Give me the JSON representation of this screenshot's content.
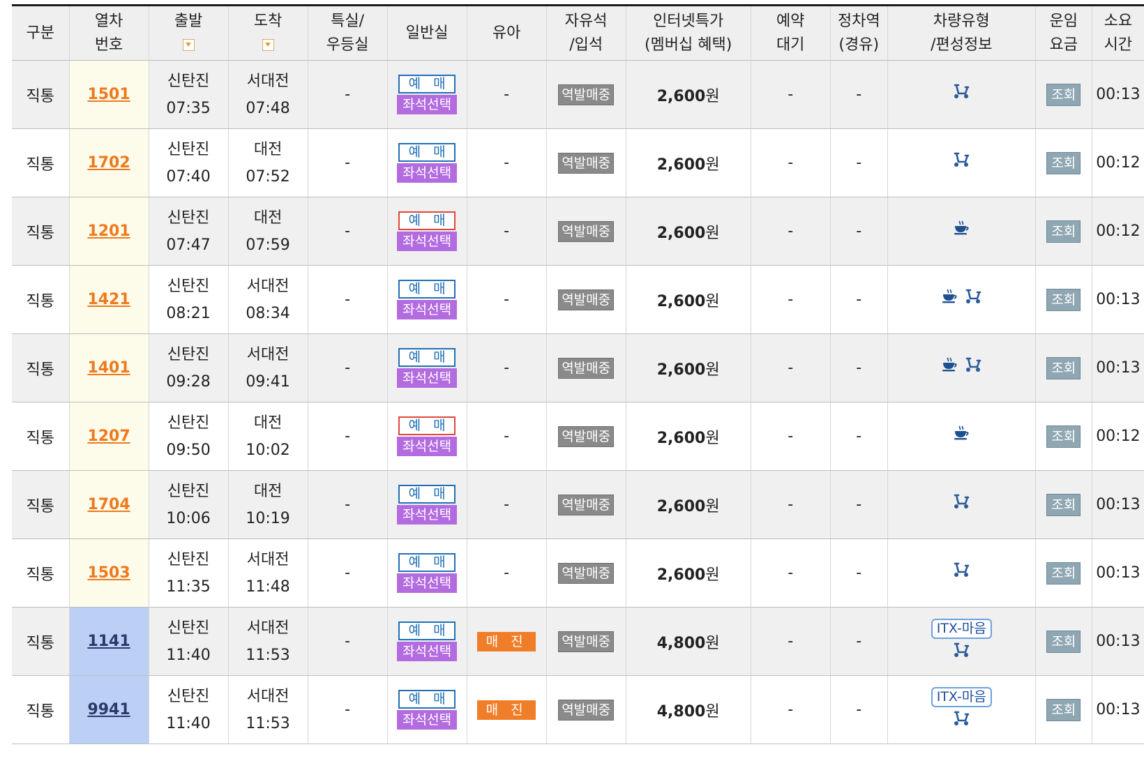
{
  "header": {
    "category": "구분",
    "train_no": [
      "열차",
      "번호"
    ],
    "depart": "출발",
    "arrive": "도착",
    "special": [
      "특실/",
      "우등실"
    ],
    "general": "일반실",
    "infant": "유아",
    "free_seat": [
      "자유석",
      "/입석"
    ],
    "internet_price": [
      "인터넷특가",
      "(멤버십 혜택)"
    ],
    "reserve_wait": [
      "예약",
      "대기"
    ],
    "stops": [
      "정차역",
      "(경유)"
    ],
    "vehicle": [
      "차량유형",
      "/편성정보"
    ],
    "fare": [
      "운임",
      "요금"
    ],
    "duration": [
      "소요",
      "시간"
    ]
  },
  "labels": {
    "yemae": "예 매",
    "seat_select": "좌석선택",
    "station_sale": "역발매중",
    "soldout": "매 진",
    "query": "조회",
    "dash": "-",
    "won": "원"
  },
  "rows": [
    {
      "category": "직통",
      "train_no": "1501",
      "itx": false,
      "dep_station": "신탄진",
      "dep_time": "07:35",
      "arr_station": "서대전",
      "arr_time": "07:48",
      "special": "-",
      "yemae_red": false,
      "infant": "-",
      "infant_soldout": false,
      "price": "2,600",
      "wait": "-",
      "stops": "-",
      "icons": [
        "bicycle-icon"
      ],
      "itx_label": "",
      "duration": "00:13"
    },
    {
      "category": "직통",
      "train_no": "1702",
      "itx": false,
      "dep_station": "신탄진",
      "dep_time": "07:40",
      "arr_station": "대전",
      "arr_time": "07:52",
      "special": "-",
      "yemae_red": false,
      "infant": "-",
      "infant_soldout": false,
      "price": "2,600",
      "wait": "-",
      "stops": "-",
      "icons": [
        "bicycle-icon"
      ],
      "itx_label": "",
      "duration": "00:12"
    },
    {
      "category": "직통",
      "train_no": "1201",
      "itx": false,
      "dep_station": "신탄진",
      "dep_time": "07:47",
      "arr_station": "대전",
      "arr_time": "07:59",
      "special": "-",
      "yemae_red": true,
      "infant": "-",
      "infant_soldout": false,
      "price": "2,600",
      "wait": "-",
      "stops": "-",
      "icons": [
        "coffee-cup-icon"
      ],
      "itx_label": "",
      "duration": "00:12"
    },
    {
      "category": "직통",
      "train_no": "1421",
      "itx": false,
      "dep_station": "신탄진",
      "dep_time": "08:21",
      "arr_station": "서대전",
      "arr_time": "08:34",
      "special": "-",
      "yemae_red": false,
      "infant": "-",
      "infant_soldout": false,
      "price": "2,600",
      "wait": "-",
      "stops": "-",
      "icons": [
        "coffee-cup-icon",
        "bicycle-icon"
      ],
      "itx_label": "",
      "duration": "00:13"
    },
    {
      "category": "직통",
      "train_no": "1401",
      "itx": false,
      "dep_station": "신탄진",
      "dep_time": "09:28",
      "arr_station": "서대전",
      "arr_time": "09:41",
      "special": "-",
      "yemae_red": false,
      "infant": "-",
      "infant_soldout": false,
      "price": "2,600",
      "wait": "-",
      "stops": "-",
      "icons": [
        "coffee-cup-icon",
        "bicycle-icon"
      ],
      "itx_label": "",
      "duration": "00:13"
    },
    {
      "category": "직통",
      "train_no": "1207",
      "itx": false,
      "dep_station": "신탄진",
      "dep_time": "09:50",
      "arr_station": "대전",
      "arr_time": "10:02",
      "special": "-",
      "yemae_red": true,
      "infant": "-",
      "infant_soldout": false,
      "price": "2,600",
      "wait": "-",
      "stops": "-",
      "icons": [
        "coffee-cup-icon"
      ],
      "itx_label": "",
      "duration": "00:12"
    },
    {
      "category": "직통",
      "train_no": "1704",
      "itx": false,
      "dep_station": "신탄진",
      "dep_time": "10:06",
      "arr_station": "대전",
      "arr_time": "10:19",
      "special": "-",
      "yemae_red": false,
      "infant": "-",
      "infant_soldout": false,
      "price": "2,600",
      "wait": "-",
      "stops": "-",
      "icons": [
        "bicycle-icon"
      ],
      "itx_label": "",
      "duration": "00:13"
    },
    {
      "category": "직통",
      "train_no": "1503",
      "itx": false,
      "dep_station": "신탄진",
      "dep_time": "11:35",
      "arr_station": "서대전",
      "arr_time": "11:48",
      "special": "-",
      "yemae_red": false,
      "infant": "-",
      "infant_soldout": false,
      "price": "2,600",
      "wait": "-",
      "stops": "-",
      "icons": [
        "bicycle-icon"
      ],
      "itx_label": "",
      "duration": "00:13"
    },
    {
      "category": "직통",
      "train_no": "1141",
      "itx": true,
      "dep_station": "신탄진",
      "dep_time": "11:40",
      "arr_station": "서대전",
      "arr_time": "11:53",
      "special": "-",
      "yemae_red": false,
      "infant": "매 진",
      "infant_soldout": true,
      "price": "4,800",
      "wait": "-",
      "stops": "-",
      "icons": [
        "bicycle-icon"
      ],
      "itx_label": "ITX-마음",
      "duration": "00:13"
    },
    {
      "category": "직통",
      "train_no": "9941",
      "itx": true,
      "dep_station": "신탄진",
      "dep_time": "11:40",
      "arr_station": "서대전",
      "arr_time": "11:53",
      "special": "-",
      "yemae_red": false,
      "infant": "매 진",
      "infant_soldout": true,
      "price": "4,800",
      "wait": "-",
      "stops": "-",
      "icons": [
        "bicycle-icon"
      ],
      "itx_label": "ITX-마음",
      "duration": "00:13"
    }
  ]
}
